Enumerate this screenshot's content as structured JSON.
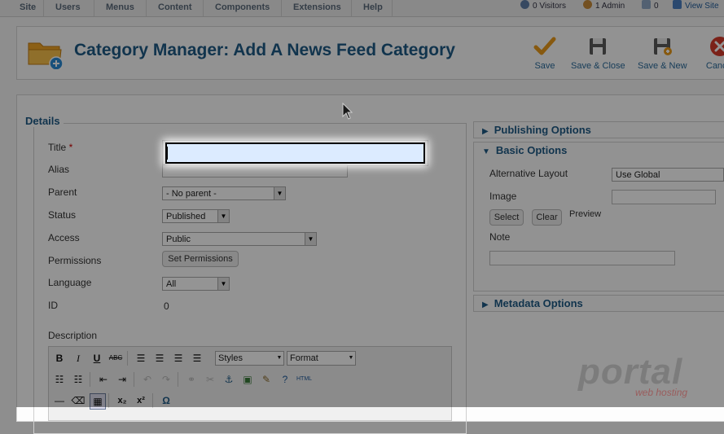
{
  "menubar": {
    "items": [
      "Site",
      "Users",
      "Menus",
      "Content",
      "Components",
      "Extensions",
      "Help"
    ],
    "visitors": "0 Visitors",
    "admins": "1 Admin",
    "messages": "0",
    "view_site": "View Site"
  },
  "header": {
    "title": "Category Manager: Add A News Feed Category",
    "toolbar": {
      "save": "Save",
      "save_close": "Save & Close",
      "save_new": "Save & New",
      "cancel": "Cancel"
    }
  },
  "details": {
    "legend": "Details",
    "title_label": "Title",
    "title_required": "*",
    "title_value": "",
    "alias_label": "Alias",
    "alias_value": "",
    "parent_label": "Parent",
    "parent_value": "- No parent -",
    "status_label": "Status",
    "status_value": "Published",
    "access_label": "Access",
    "access_value": "Public",
    "permissions_label": "Permissions",
    "permissions_button": "Set Permissions",
    "language_label": "Language",
    "language_value": "All",
    "id_label": "ID",
    "id_value": "0",
    "description_label": "Description"
  },
  "editor": {
    "styles": "Styles",
    "format": "Format"
  },
  "panels": {
    "publishing": "Publishing Options",
    "basic": "Basic Options",
    "alt_layout_label": "Alternative Layout",
    "alt_layout_value": "Use Global",
    "image_label": "Image",
    "select_button": "Select",
    "clear_button": "Clear",
    "preview_label": "Preview",
    "note_label": "Note",
    "metadata": "Metadata Options"
  },
  "watermark": {
    "brand": "portal",
    "tagline": "web hosting"
  }
}
